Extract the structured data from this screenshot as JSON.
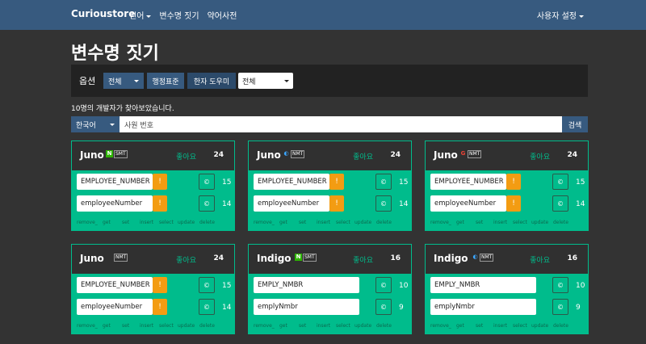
{
  "navbar": {
    "brand": "Curioustore",
    "links": [
      "언어",
      "변수명 짓기",
      "약어사전"
    ],
    "user": "사용자 설정"
  },
  "page": {
    "title": "변수명 짓기"
  },
  "options": {
    "label": "옵션",
    "select1": "전체",
    "btn_admin": "행정표준",
    "btn_hanja": "한자 도우미",
    "select2": "전체"
  },
  "count_text": "10명의 개발자가 찾아보았습니다.",
  "search": {
    "lang": "한국어",
    "value": "사원 번호",
    "button": "검색"
  },
  "cards": [
    {
      "name": "Juno",
      "engine": "SMT",
      "engine_icon": "naver-icon",
      "like_label": "좋아요",
      "likes": "24",
      "results": [
        {
          "text": "EMPLOYEE_NUMBER",
          "warn": "!",
          "count": "15"
        },
        {
          "text": "employeeNumber",
          "warn": "!",
          "count": "14"
        }
      ]
    },
    {
      "name": "Juno",
      "engine": "NMT",
      "engine_icon": "papago-icon",
      "like_label": "좋아요",
      "likes": "24",
      "results": [
        {
          "text": "EMPLOYEE_NUMBER",
          "warn": "!",
          "count": "15"
        },
        {
          "text": "employeeNumber",
          "warn": "!",
          "count": "14"
        }
      ]
    },
    {
      "name": "Juno",
      "engine": "NMT",
      "engine_icon": "google-icon",
      "like_label": "좋아요",
      "likes": "24",
      "results": [
        {
          "text": "EMPLOYEE_NUMBER",
          "warn": "!",
          "count": "15"
        },
        {
          "text": "employeeNumber",
          "warn": "!",
          "count": "14"
        }
      ]
    },
    {
      "name": "Juno",
      "engine": "NMT",
      "engine_icon": "other-icon",
      "like_label": "좋아요",
      "likes": "24",
      "results": [
        {
          "text": "EMPLOYEE_NUMBER",
          "warn": "!",
          "count": "15"
        },
        {
          "text": "employeeNumber",
          "warn": "!",
          "count": "14"
        }
      ]
    },
    {
      "name": "Indigo",
      "engine": "SMT",
      "engine_icon": "naver-icon",
      "like_label": "좋아요",
      "likes": "16",
      "results": [
        {
          "text": "EMPLY_NMBR",
          "warn": "",
          "count": "10"
        },
        {
          "text": "emplyNmbr",
          "warn": "",
          "count": "9"
        }
      ]
    },
    {
      "name": "Indigo",
      "engine": "NMT",
      "engine_icon": "papago-icon",
      "like_label": "좋아요",
      "likes": "16",
      "results": [
        {
          "text": "EMPLY_NMBR",
          "warn": "",
          "count": "10"
        },
        {
          "text": "emplyNmbr",
          "warn": "",
          "count": "9"
        }
      ]
    }
  ],
  "copy_symbol": "©",
  "prefixes": [
    "remove_",
    "get",
    "set",
    "insert",
    "select",
    "update",
    "delete"
  ],
  "colors": {
    "navbar": "#375a7f",
    "accent": "#00bc8c",
    "warning": "#f39c12",
    "background": "#333333"
  }
}
